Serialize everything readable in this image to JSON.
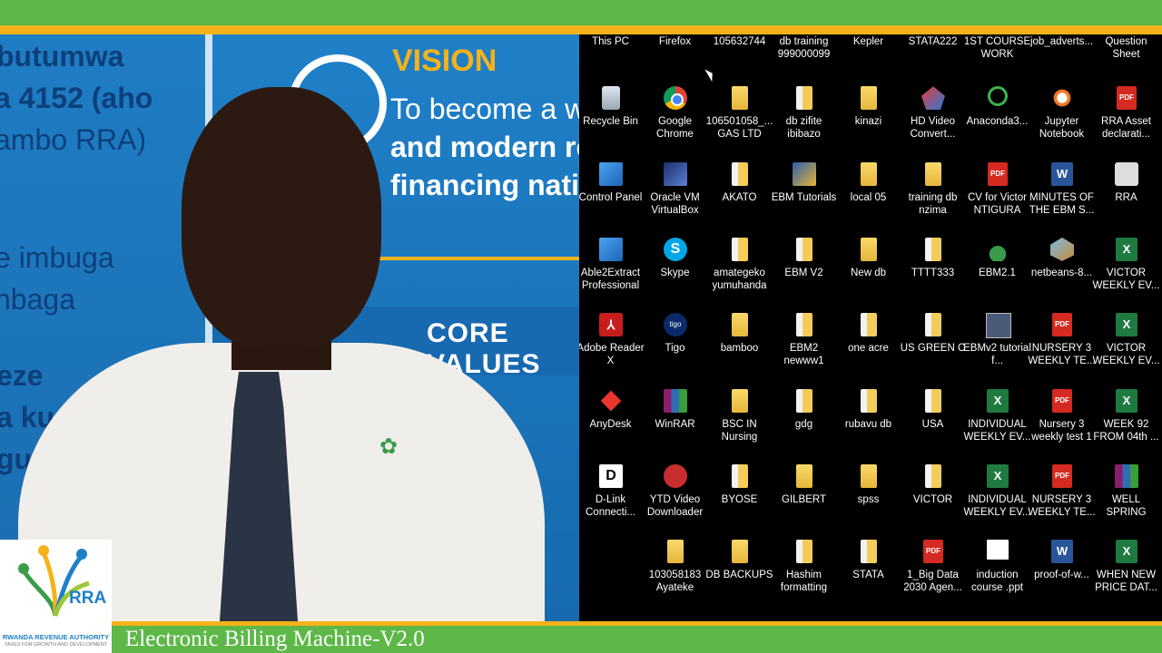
{
  "presenter": {
    "banner_left_lines": [
      "butumwa",
      "a 4152 (aho",
      "ambo RRA)",
      "e imbuga",
      "nbaga",
      "eze",
      "a ku",
      "gu"
    ],
    "vision_title": "VISION",
    "vision_lines": [
      "To become a w",
      "and modern reve",
      "financing natio"
    ],
    "core_values": "CORE VALUES",
    "logo": {
      "short_name": "RRA",
      "full_name": "RWANDA REVENUE AUTHORITY",
      "tagline": "TAXES FOR GROWTH AND DEVELOPMENT"
    }
  },
  "caption": "Electronic Billing Machine-V2.0",
  "colors": {
    "green": "#5db848",
    "yellow": "#f6b21a",
    "blue": "#1f80c8"
  },
  "desktop": {
    "icons": [
      {
        "label": "This PC",
        "icon": "computer-icon",
        "kind": "none"
      },
      {
        "label": "Firefox",
        "icon": "firefox-icon",
        "kind": "none"
      },
      {
        "label": "105632744",
        "icon": "folder-icon",
        "kind": "none"
      },
      {
        "label": "db training 999000099",
        "icon": "folder-icon",
        "kind": "none"
      },
      {
        "label": "Kepler",
        "icon": "folder-icon",
        "kind": "none"
      },
      {
        "label": "STATA222",
        "icon": "folder-icon",
        "kind": "none"
      },
      {
        "label": "1ST COURSE WORK",
        "icon": "folder-icon",
        "kind": "none"
      },
      {
        "label": "job_adverts...",
        "icon": "folder-icon",
        "kind": "none"
      },
      {
        "label": "Question Sheet",
        "icon": "document-icon",
        "kind": "none"
      },
      {
        "label": "Recycle Bin",
        "icon": "recycle-bin-icon",
        "kind": "ic-recycle"
      },
      {
        "label": "Google Chrome",
        "icon": "chrome-icon",
        "kind": "ic-chrome"
      },
      {
        "label": "106501058_... GAS LTD",
        "icon": "folder-icon",
        "kind": "ic-folder"
      },
      {
        "label": "db zifite ibibazo",
        "icon": "folder-icon",
        "kind": "ic-folder-doc"
      },
      {
        "label": "kinazi",
        "icon": "folder-icon",
        "kind": "ic-folder"
      },
      {
        "label": "HD Video Convert...",
        "icon": "hd-video-converter-icon",
        "kind": "ic-hd"
      },
      {
        "label": "Anaconda3...",
        "icon": "anaconda-icon",
        "kind": "ic-anaconda"
      },
      {
        "label": "Jupyter Notebook",
        "icon": "jupyter-icon",
        "kind": "ic-jupyter"
      },
      {
        "label": "RRA Asset declarati...",
        "icon": "pdf-icon",
        "kind": "ic-pdf"
      },
      {
        "label": "Control Panel",
        "icon": "control-panel-icon",
        "kind": "ic-control"
      },
      {
        "label": "Oracle VM VirtualBox",
        "icon": "virtualbox-icon",
        "kind": "ic-box"
      },
      {
        "label": "AKATO",
        "icon": "folder-icon",
        "kind": "ic-folder-doc"
      },
      {
        "label": "EBM Tutorials",
        "icon": "ebm-icon",
        "kind": "ic-ebm"
      },
      {
        "label": "local 05",
        "icon": "folder-icon",
        "kind": "ic-folder"
      },
      {
        "label": "training db nzima",
        "icon": "folder-icon",
        "kind": "ic-folder"
      },
      {
        "label": "CV for Victor NTIGURA",
        "icon": "pdf-icon",
        "kind": "ic-pdf"
      },
      {
        "label": "MINUTES OF THE EBM S...",
        "icon": "word-icon",
        "kind": "ic-word"
      },
      {
        "label": "RRA",
        "icon": "settings-file-icon",
        "kind": "ic-rra"
      },
      {
        "label": "Able2Extract Professional",
        "icon": "able2extract-icon",
        "kind": "ic-control"
      },
      {
        "label": "Skype",
        "icon": "skype-icon",
        "kind": "ic-skype"
      },
      {
        "label": "amategeko yumuhanda",
        "icon": "folder-icon",
        "kind": "ic-folder-doc"
      },
      {
        "label": "EBM V2",
        "icon": "folder-icon",
        "kind": "ic-folder-doc"
      },
      {
        "label": "New db",
        "icon": "folder-icon",
        "kind": "ic-folder"
      },
      {
        "label": "TTTT333",
        "icon": "folder-icon",
        "kind": "ic-folder-doc"
      },
      {
        "label": "EBM2.1",
        "icon": "ebm21-icon",
        "kind": "ic-ebm21"
      },
      {
        "label": "netbeans-8...",
        "icon": "netbeans-icon",
        "kind": "ic-netbeans"
      },
      {
        "label": "VICTOR WEEKLY EV...",
        "icon": "excel-icon",
        "kind": "ic-excel"
      },
      {
        "label": "Adobe Reader X",
        "icon": "adobe-reader-icon",
        "kind": "ic-adobe"
      },
      {
        "label": "Tigo",
        "icon": "tigo-icon",
        "kind": "ic-tigo"
      },
      {
        "label": "bamboo",
        "icon": "folder-icon",
        "kind": "ic-folder"
      },
      {
        "label": "EBM2 newww1",
        "icon": "folder-icon",
        "kind": "ic-folder-doc"
      },
      {
        "label": "one acre",
        "icon": "folder-icon",
        "kind": "ic-folder-doc"
      },
      {
        "label": "US GREEN C",
        "icon": "folder-icon",
        "kind": "ic-folder-doc"
      },
      {
        "label": "EBMv2 tutorial f...",
        "icon": "video-file-icon",
        "kind": "ic-ebmv2"
      },
      {
        "label": "NURSERY 3 WEEKLY TE...",
        "icon": "pdf-icon",
        "kind": "ic-pdf"
      },
      {
        "label": "VICTOR WEEKLY EV...",
        "icon": "excel-icon",
        "kind": "ic-excel"
      },
      {
        "label": "AnyDesk",
        "icon": "anydesk-icon",
        "kind": "ic-anydesk"
      },
      {
        "label": "WinRAR",
        "icon": "winrar-icon",
        "kind": "ic-winrar"
      },
      {
        "label": "BSC IN Nursing",
        "icon": "folder-icon",
        "kind": "ic-folder"
      },
      {
        "label": "gdg",
        "icon": "folder-icon",
        "kind": "ic-folder-doc"
      },
      {
        "label": "rubavu db",
        "icon": "folder-icon",
        "kind": "ic-folder-doc"
      },
      {
        "label": "USA",
        "icon": "folder-icon",
        "kind": "ic-folder-doc"
      },
      {
        "label": "INDIVIDUAL WEEKLY EV...",
        "icon": "excel-icon",
        "kind": "ic-excel"
      },
      {
        "label": "Nursery 3 weekly test 1",
        "icon": "pdf-icon",
        "kind": "ic-pdf"
      },
      {
        "label": "WEEK 92 FROM 04th ...",
        "icon": "excel-icon",
        "kind": "ic-excel"
      },
      {
        "label": "D-Link Connecti...",
        "icon": "dlink-icon",
        "kind": "ic-dlink"
      },
      {
        "label": "YTD Video Downloader",
        "icon": "ytd-downloader-icon",
        "kind": "ic-video"
      },
      {
        "label": "BYOSE",
        "icon": "folder-icon",
        "kind": "ic-folder-doc"
      },
      {
        "label": "GILBERT",
        "icon": "folder-icon",
        "kind": "ic-folder"
      },
      {
        "label": "spss",
        "icon": "folder-icon",
        "kind": "ic-folder"
      },
      {
        "label": "VICTOR",
        "icon": "folder-icon",
        "kind": "ic-folder-doc"
      },
      {
        "label": "INDIVIDUAL WEEKLY EV...",
        "icon": "excel-icon",
        "kind": "ic-excel"
      },
      {
        "label": "NURSERY 3 WEEKLY TE...",
        "icon": "pdf-icon",
        "kind": "ic-pdf"
      },
      {
        "label": "WELL SPRING",
        "icon": "winrar-icon",
        "kind": "ic-winrar"
      },
      {
        "label": "",
        "icon": "",
        "kind": "skip"
      },
      {
        "label": "103058183 Ayateke",
        "icon": "folder-icon",
        "kind": "ic-folder"
      },
      {
        "label": "DB BACKUPS",
        "icon": "folder-icon",
        "kind": "ic-folder"
      },
      {
        "label": "Hashim formatting",
        "icon": "folder-icon",
        "kind": "ic-folder-doc"
      },
      {
        "label": "STATA",
        "icon": "folder-icon",
        "kind": "ic-folder-doc"
      },
      {
        "label": "1_Big Data 2030 Agen...",
        "icon": "pdf-icon",
        "kind": "ic-pdf"
      },
      {
        "label": "induction course .ppt",
        "icon": "ppt-file-icon",
        "kind": "ic-induction"
      },
      {
        "label": "proof-of-w...",
        "icon": "word-icon",
        "kind": "ic-word"
      },
      {
        "label": "WHEN NEW PRICE DAT...",
        "icon": "excel-icon",
        "kind": "ic-excel"
      }
    ]
  }
}
